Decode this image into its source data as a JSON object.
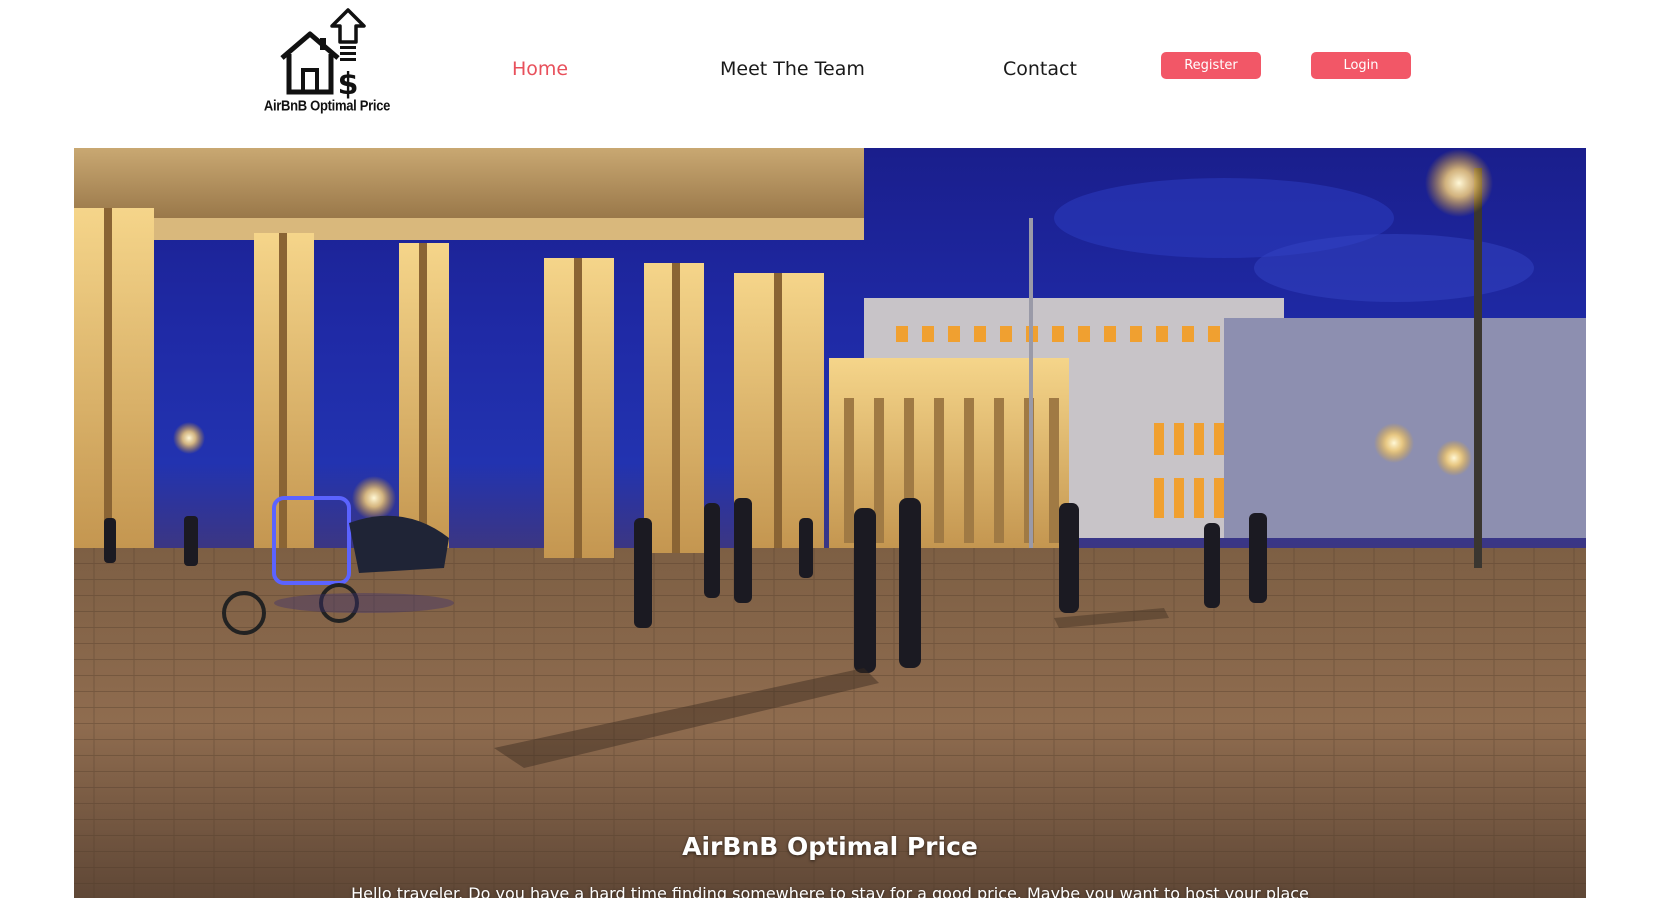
{
  "header": {
    "logo_text": "AirBnB Optimal Price",
    "logo_icon": "house-dollar-arrow-icon"
  },
  "nav": {
    "items": [
      {
        "label": "Home",
        "active": true
      },
      {
        "label": "Meet The Team",
        "active": false
      },
      {
        "label": "Contact",
        "active": false
      }
    ]
  },
  "auth": {
    "register_label": "Register",
    "login_label": "Login"
  },
  "hero": {
    "title": "AirBnB Optimal Price",
    "text": "Hello traveler. Do you have a hard time finding somewhere to stay for a good price. Maybe you want to host your place",
    "image_subject": "Brandenburg Gate at night"
  },
  "colors": {
    "accent": "#f25767",
    "active_link": "#e8505b"
  }
}
